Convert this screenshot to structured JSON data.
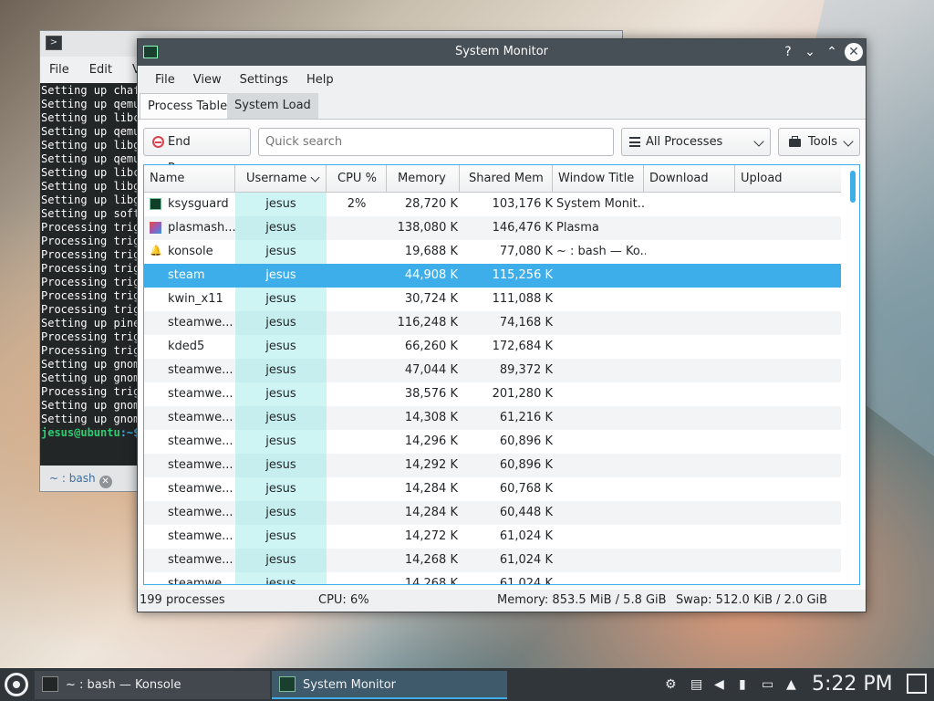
{
  "konsole": {
    "menu": [
      "File",
      "Edit",
      "Vi"
    ],
    "lines": [
      "Setting up chaf",
      "Setting up qemu",
      "Setting up libc",
      "Setting up qemu",
      "Setting up libg",
      "Setting up qemu",
      "Setting up libc",
      "Setting up libg",
      "Setting up libg",
      "Setting up soft",
      "Processing trig",
      "Processing trig",
      "Processing trig",
      "Processing trig",
      "Processing trig",
      "Processing trig",
      "Processing trig",
      "Setting up pine",
      "Processing trig",
      "Processing trig",
      "Setting up gnom",
      "Setting up gnom",
      "Processing trig",
      "Setting up gnom",
      "Setting up gnom"
    ],
    "prompt_user": "jesus@ubuntu",
    "prompt_path": ":~$",
    "tab_label": "~ : bash"
  },
  "sysmon": {
    "title": "System Monitor",
    "controls": {
      "help": "?",
      "minimize": "⌄",
      "maximize": "⌃",
      "close": "✕"
    },
    "menu": [
      "File",
      "View",
      "Settings",
      "Help"
    ],
    "tabs": [
      "Process Table",
      "System Load"
    ],
    "toolbar": {
      "end_process": "End Process...",
      "search_placeholder": "Quick search",
      "filter": "All Processes",
      "tools": "Tools"
    },
    "columns": [
      "Name",
      "Username",
      "CPU %",
      "Memory",
      "Shared Mem",
      "Window Title",
      "Download",
      "Upload"
    ],
    "rows": [
      {
        "name": "ksysguard",
        "user": "jesus",
        "cpu": "2%",
        "mem": "28,720 K",
        "shared": "103,176 K",
        "wt": "System Monit..."
      },
      {
        "name": "plasmash...",
        "user": "jesus",
        "cpu": "",
        "mem": "138,080 K",
        "shared": "146,476 K",
        "wt": "Plasma"
      },
      {
        "name": "konsole",
        "user": "jesus",
        "cpu": "",
        "mem": "19,688 K",
        "shared": "77,080 K",
        "wt": "~ : bash — Ko..."
      },
      {
        "name": "steam",
        "user": "jesus",
        "cpu": "",
        "mem": "44,908 K",
        "shared": "115,256 K",
        "wt": ""
      },
      {
        "name": "kwin_x11",
        "user": "jesus",
        "cpu": "",
        "mem": "30,724 K",
        "shared": "111,088 K",
        "wt": ""
      },
      {
        "name": "steamwe...",
        "user": "jesus",
        "cpu": "",
        "mem": "116,248 K",
        "shared": "74,168 K",
        "wt": ""
      },
      {
        "name": "kded5",
        "user": "jesus",
        "cpu": "",
        "mem": "66,260 K",
        "shared": "172,684 K",
        "wt": ""
      },
      {
        "name": "steamwe...",
        "user": "jesus",
        "cpu": "",
        "mem": "47,044 K",
        "shared": "89,372 K",
        "wt": ""
      },
      {
        "name": "steamwe...",
        "user": "jesus",
        "cpu": "",
        "mem": "38,576 K",
        "shared": "201,280 K",
        "wt": ""
      },
      {
        "name": "steamwe...",
        "user": "jesus",
        "cpu": "",
        "mem": "14,308 K",
        "shared": "61,216 K",
        "wt": ""
      },
      {
        "name": "steamwe...",
        "user": "jesus",
        "cpu": "",
        "mem": "14,296 K",
        "shared": "60,896 K",
        "wt": ""
      },
      {
        "name": "steamwe...",
        "user": "jesus",
        "cpu": "",
        "mem": "14,292 K",
        "shared": "60,896 K",
        "wt": ""
      },
      {
        "name": "steamwe...",
        "user": "jesus",
        "cpu": "",
        "mem": "14,284 K",
        "shared": "60,768 K",
        "wt": ""
      },
      {
        "name": "steamwe...",
        "user": "jesus",
        "cpu": "",
        "mem": "14,284 K",
        "shared": "60,448 K",
        "wt": ""
      },
      {
        "name": "steamwe...",
        "user": "jesus",
        "cpu": "",
        "mem": "14,272 K",
        "shared": "61,024 K",
        "wt": ""
      },
      {
        "name": "steamwe...",
        "user": "jesus",
        "cpu": "",
        "mem": "14,268 K",
        "shared": "61,024 K",
        "wt": ""
      },
      {
        "name": "steamwe...",
        "user": "jesus",
        "cpu": "",
        "mem": "14,268 K",
        "shared": "61,024 K",
        "wt": ""
      }
    ],
    "selected_row": 3,
    "status": {
      "processes": "199 processes",
      "cpu": "CPU: 6%",
      "memory": "Memory: 853.5 MiB / 5.8 GiB",
      "swap": "Swap: 512.0 KiB / 2.0 GiB"
    }
  },
  "taskbar": {
    "tasks": [
      "~ : bash — Konsole",
      "System Monitor"
    ],
    "clock": "5:22 PM"
  },
  "colors": {
    "accent": "#3daee9",
    "titlebar": "#475057",
    "panel": "#31363b"
  }
}
